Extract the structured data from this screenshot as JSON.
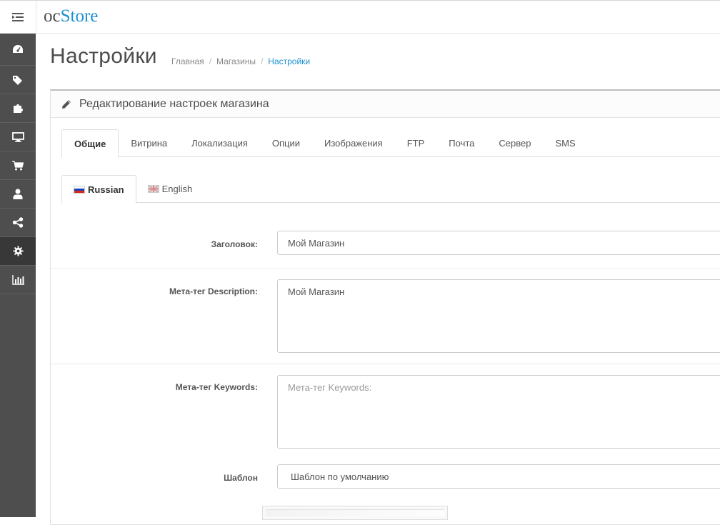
{
  "header": {
    "logo_oc": "oc",
    "logo_store": "Store"
  },
  "sidebar": {
    "items": [
      {
        "name": "dashboard-icon"
      },
      {
        "name": "tags-icon"
      },
      {
        "name": "puzzle-icon"
      },
      {
        "name": "desktop-icon"
      },
      {
        "name": "cart-icon"
      },
      {
        "name": "user-icon"
      },
      {
        "name": "share-icon"
      },
      {
        "name": "cog-icon",
        "active": true
      },
      {
        "name": "bar-chart-icon"
      }
    ]
  },
  "page": {
    "title": "Настройки",
    "breadcrumb": [
      "Главная",
      "Магазины",
      "Настройки"
    ]
  },
  "panel": {
    "heading": "Редактирование настроек магазина",
    "tabs": [
      "Общие",
      "Витрина",
      "Локализация",
      "Опции",
      "Изображения",
      "FTP",
      "Почта",
      "Сервер",
      "SMS"
    ],
    "lang_tabs": [
      "Russian",
      "English"
    ]
  },
  "form": {
    "title_label": "Заголовок:",
    "title_value": "Мой Магазин",
    "meta_desc_label": "Мета-тег Description:",
    "meta_desc_value": "Мой Магазин",
    "meta_kw_label": "Мета-тег Keywords:",
    "meta_kw_placeholder": "Мета-тег Keywords:",
    "template_label": "Шаблон",
    "template_value": "Шаблон по умолчанию"
  },
  "colors": {
    "accent": "#1e91cf",
    "sidebar": "#4e4e4e",
    "sidebar_active": "#383838"
  }
}
